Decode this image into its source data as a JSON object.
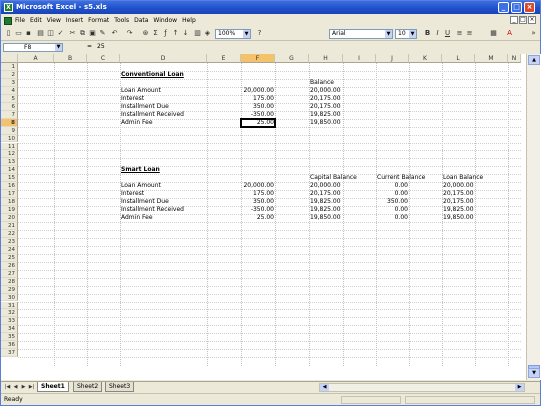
{
  "window": {
    "title": "Microsoft Excel - s5.xls"
  },
  "menubar": {
    "items": [
      "File",
      "Edit",
      "View",
      "Insert",
      "Format",
      "Tools",
      "Data",
      "Window",
      "Help"
    ]
  },
  "toolbar": {
    "zoom": "100%",
    "font": "Arial",
    "font_size": "10"
  },
  "formula_bar": {
    "name_box": "F8",
    "fx": "=",
    "value": "25"
  },
  "columns": [
    "A",
    "B",
    "C",
    "D",
    "E",
    "F",
    "G",
    "H",
    "I",
    "J",
    "K",
    "L",
    "M",
    "N"
  ],
  "rows": [
    "1",
    "2",
    "3",
    "4",
    "5",
    "6",
    "7",
    "8",
    "9",
    "10",
    "11",
    "12",
    "13",
    "14",
    "15",
    "16",
    "17",
    "18",
    "19",
    "20",
    "21",
    "22",
    "23",
    "24",
    "25",
    "26",
    "27",
    "28",
    "29",
    "30",
    "31",
    "32",
    "33",
    "34",
    "35",
    "36",
    "37"
  ],
  "selected": {
    "col": "F",
    "row": "8"
  },
  "sheet": {
    "conv_title": "Conventional Loan",
    "conv_balance_hdr": "Balance",
    "conv_rows": [
      {
        "label": "Loan Amount",
        "amount": "20,000.00",
        "balance": "20,000.00"
      },
      {
        "label": "Interest",
        "amount": "175.00",
        "balance": "20,175.00"
      },
      {
        "label": "Installment Due",
        "amount": "350.00",
        "balance": "20,175.00"
      },
      {
        "label": "Installment Received",
        "amount": "-350.00",
        "balance": "19,825.00"
      },
      {
        "label": "Admin Fee",
        "amount": "25.00",
        "balance": "19,850.00"
      }
    ],
    "smart_title": "Smart Loan",
    "smart_headers": {
      "capital": "Capital Balance",
      "current": "Current Balance",
      "loan": "Loan Balance"
    },
    "smart_rows": [
      {
        "label": "Loan Amount",
        "amount": "20,000.00",
        "capital": "20,000.00",
        "current": "0.00",
        "loan": "20,000.00"
      },
      {
        "label": "Interest",
        "amount": "175.00",
        "capital": "20,175.00",
        "current": "0.00",
        "loan": "20,175.00"
      },
      {
        "label": "Installment Due",
        "amount": "350.00",
        "capital": "19,825.00",
        "current": "350.00",
        "loan": "20,175.00"
      },
      {
        "label": "Installment Received",
        "amount": "-350.00",
        "capital": "19,825.00",
        "current": "0.00",
        "loan": "19,825.00"
      },
      {
        "label": "Admin Fee",
        "amount": "25.00",
        "capital": "19,850.00",
        "current": "0.00",
        "loan": "19,850.00"
      }
    ]
  },
  "tabs": [
    "Sheet1",
    "Sheet2",
    "Sheet3"
  ],
  "active_tab": "Sheet1",
  "status": {
    "text": "Ready"
  }
}
